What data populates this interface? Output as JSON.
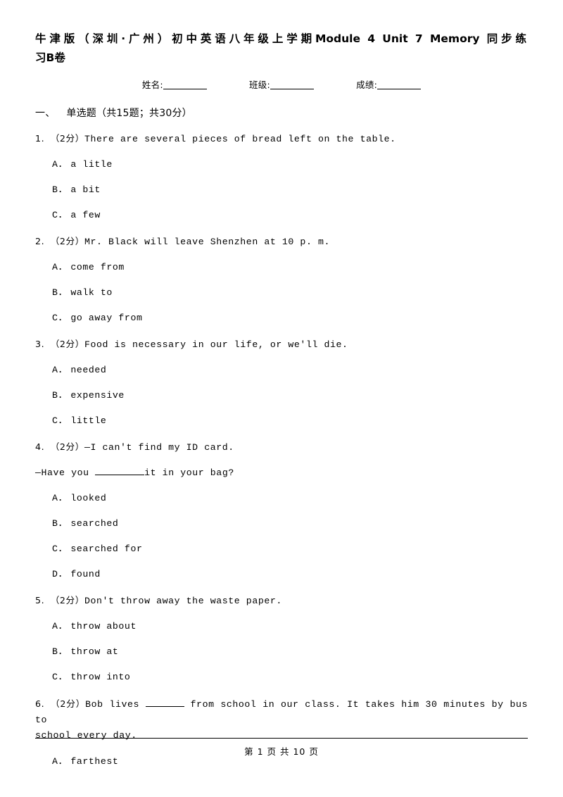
{
  "document": {
    "title_line1": "牛津版（深圳·广州）初中英语八年级上学期Module 4 Unit 7 Memory 同步练",
    "title_line2": "习B卷",
    "id_fields": [
      {
        "label": "姓名:"
      },
      {
        "label": "班级:"
      },
      {
        "label": "成绩:"
      }
    ],
    "section": {
      "number": "一、",
      "name": "单选题",
      "meta": "（共15题；共30分）"
    },
    "questions": [
      {
        "num": "1.",
        "marks": "（2分）",
        "text": "There are several pieces of bread left on the table.",
        "options": [
          {
            "label": "A．",
            "text": "a litle"
          },
          {
            "label": "B．",
            "text": "a bit"
          },
          {
            "label": "C．",
            "text": "a few"
          }
        ]
      },
      {
        "num": "2.",
        "marks": "（2分）",
        "text": "Mr. Black will leave Shenzhen at 10 p. m.",
        "options": [
          {
            "label": "A．",
            "text": "come from"
          },
          {
            "label": "B．",
            "text": "walk to"
          },
          {
            "label": "C．",
            "text": "go away from"
          }
        ]
      },
      {
        "num": "3.",
        "marks": "（2分）",
        "text": "Food is necessary in our life, or we'll die.",
        "options": [
          {
            "label": "A．",
            "text": "needed"
          },
          {
            "label": "B．",
            "text": "expensive"
          },
          {
            "label": "C．",
            "text": "little"
          }
        ]
      },
      {
        "num": "4.",
        "marks": "（2分）",
        "text": "—I can't find my ID card.",
        "continuation_before": "—Have you ",
        "continuation_after": "it in your bag?",
        "options": [
          {
            "label": "A．",
            "text": "looked"
          },
          {
            "label": "B．",
            "text": "searched"
          },
          {
            "label": "C．",
            "text": "searched for"
          },
          {
            "label": "D．",
            "text": "found"
          }
        ]
      },
      {
        "num": "5.",
        "marks": "（2分）",
        "text": "Don't throw away the waste paper.",
        "options": [
          {
            "label": "A．",
            "text": "throw about"
          },
          {
            "label": "B．",
            "text": "throw at"
          },
          {
            "label": "C．",
            "text": "throw into"
          }
        ]
      },
      {
        "num": "6.",
        "marks": "（2分）",
        "text_before_blank": "Bob lives ",
        "text_after_blank": " from school in our class. It takes him 30 minutes by bus to",
        "text_line2": "school every day.",
        "options": [
          {
            "label": "A．",
            "text": "farthest"
          }
        ]
      }
    ]
  },
  "footer": {
    "text": "第 1 页 共 10 页"
  }
}
